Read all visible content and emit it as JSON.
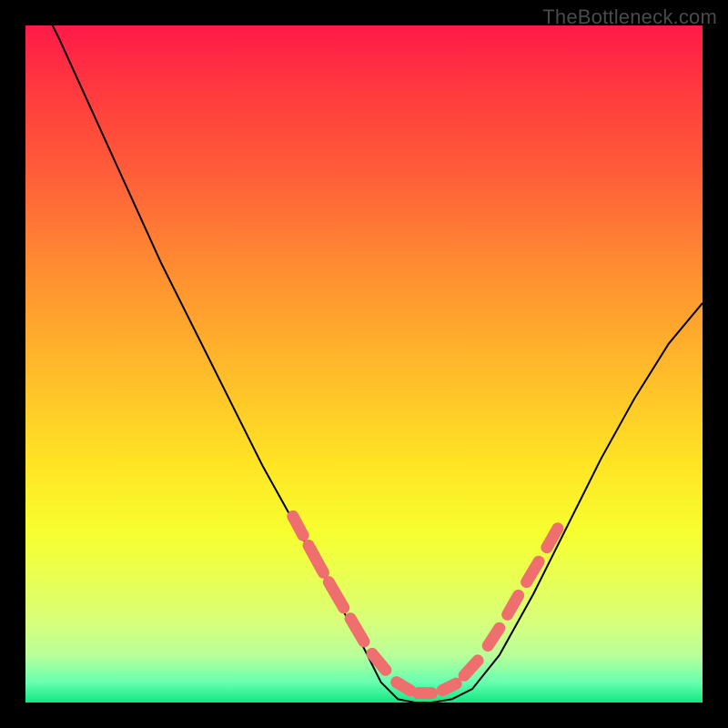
{
  "watermark": "TheBottleneck.com",
  "chart_data": {
    "type": "line",
    "title": "",
    "xlabel": "",
    "ylabel": "",
    "xlim": [
      0,
      1
    ],
    "ylim": [
      0,
      1
    ],
    "series": [
      {
        "name": "curve",
        "x": [
          0.0,
          0.05,
          0.1,
          0.15,
          0.2,
          0.25,
          0.3,
          0.35,
          0.4,
          0.45,
          0.5,
          0.525,
          0.55,
          0.575,
          0.6,
          0.63,
          0.66,
          0.7,
          0.75,
          0.8,
          0.85,
          0.9,
          0.95,
          1.0
        ],
        "values": [
          1.08,
          0.98,
          0.87,
          0.76,
          0.65,
          0.55,
          0.45,
          0.35,
          0.26,
          0.17,
          0.08,
          0.03,
          0.005,
          0.0,
          0.0,
          0.005,
          0.02,
          0.07,
          0.16,
          0.26,
          0.36,
          0.45,
          0.53,
          0.59
        ]
      },
      {
        "name": "highlight-dashes",
        "segments": [
          {
            "x0": 0.395,
            "y0": 0.275,
            "x1": 0.41,
            "y1": 0.247
          },
          {
            "x0": 0.418,
            "y0": 0.232,
            "x1": 0.44,
            "y1": 0.192
          },
          {
            "x0": 0.448,
            "y0": 0.178,
            "x1": 0.47,
            "y1": 0.14
          },
          {
            "x0": 0.48,
            "y0": 0.124,
            "x1": 0.5,
            "y1": 0.09
          },
          {
            "x0": 0.512,
            "y0": 0.072,
            "x1": 0.532,
            "y1": 0.048
          },
          {
            "x0": 0.548,
            "y0": 0.03,
            "x1": 0.568,
            "y1": 0.018
          },
          {
            "x0": 0.58,
            "y0": 0.014,
            "x1": 0.6,
            "y1": 0.014
          },
          {
            "x0": 0.616,
            "y0": 0.018,
            "x1": 0.636,
            "y1": 0.028
          },
          {
            "x0": 0.648,
            "y0": 0.04,
            "x1": 0.668,
            "y1": 0.062
          },
          {
            "x0": 0.683,
            "y0": 0.084,
            "x1": 0.7,
            "y1": 0.11
          },
          {
            "x0": 0.712,
            "y0": 0.13,
            "x1": 0.728,
            "y1": 0.158
          },
          {
            "x0": 0.74,
            "y0": 0.178,
            "x1": 0.758,
            "y1": 0.208
          },
          {
            "x0": 0.77,
            "y0": 0.229,
            "x1": 0.786,
            "y1": 0.257
          }
        ]
      }
    ],
    "colors": {
      "curve": "#000000",
      "highlight": "#ef6e6e",
      "background_top": "#ff1a49",
      "background_bottom": "#12e783",
      "frame": "#000000"
    }
  }
}
